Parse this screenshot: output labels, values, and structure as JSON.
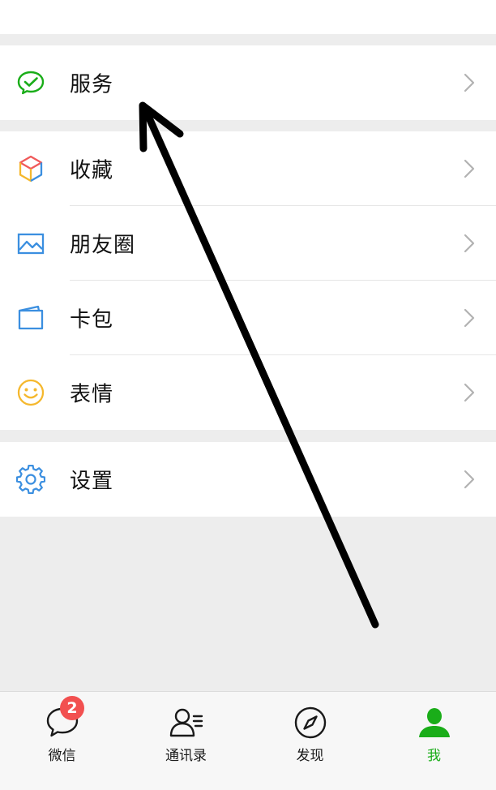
{
  "menu": {
    "services": {
      "label": "服务",
      "icon": "wechat-pay-icon"
    },
    "group2": [
      {
        "key": "favorites",
        "label": "收藏",
        "icon": "cube-icon"
      },
      {
        "key": "moments",
        "label": "朋友圈",
        "icon": "image-icon"
      },
      {
        "key": "cards",
        "label": "卡包",
        "icon": "card-icon"
      },
      {
        "key": "stickers",
        "label": "表情",
        "icon": "smiley-icon"
      }
    ],
    "settings": {
      "label": "设置",
      "icon": "gear-icon"
    }
  },
  "tabbar": {
    "tabs": [
      {
        "key": "chats",
        "label": "微信",
        "icon": "chat-icon",
        "badge": "2"
      },
      {
        "key": "contacts",
        "label": "通讯录",
        "icon": "contacts-icon"
      },
      {
        "key": "discover",
        "label": "发现",
        "icon": "compass-icon"
      },
      {
        "key": "me",
        "label": "我",
        "icon": "person-icon",
        "active": true
      }
    ]
  },
  "colors": {
    "background": "#ededed",
    "accent_green": "#1aad19",
    "badge_red": "#f25050",
    "text": "#111111",
    "chevron": "#b2b2b2"
  },
  "annotation": {
    "type": "hand-drawn-arrow",
    "points_to": "services",
    "color": "#000000"
  }
}
